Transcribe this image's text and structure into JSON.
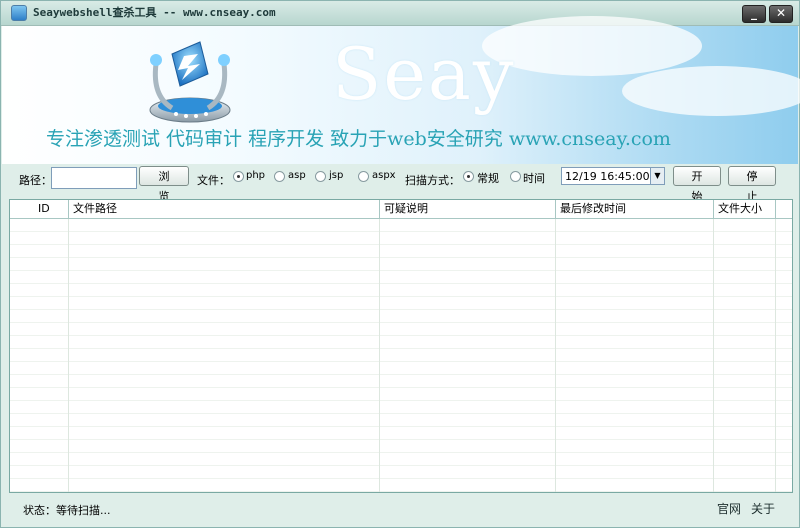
{
  "titlebar": {
    "title": "Seaywebshell查杀工具 -- www.cnseay.com",
    "minimize_glyph": "_",
    "close_glyph": "✕"
  },
  "banner": {
    "brand": "Seay",
    "slogan": "专注渗透测试 代码审计 程序开发 致力于web安全研究 www.cnseay.com"
  },
  "toolbar": {
    "path_label": "路径：",
    "path_value": "",
    "browse_label": "浏 览",
    "file_label": "文件：",
    "file_types": [
      {
        "label": "php",
        "checked": true
      },
      {
        "label": "asp",
        "checked": false
      },
      {
        "label": "jsp",
        "checked": false
      },
      {
        "label": "aspx",
        "checked": false
      }
    ],
    "scan_mode_label": "扫描方式：",
    "scan_modes": [
      {
        "label": "常规",
        "checked": true
      },
      {
        "label": "时间",
        "checked": false
      }
    ],
    "datetime_value": "12/19 16:45:00",
    "start_label": "开 始",
    "stop_label": "停 止"
  },
  "table": {
    "columns": [
      "ID",
      "文件路径",
      "可疑说明",
      "最后修改时间",
      "文件大小"
    ],
    "rows": []
  },
  "statusbar": {
    "status": "状态：等待扫描...",
    "official_site": "官网",
    "about": "关于"
  },
  "colors": {
    "window_bg": "#dfeee9",
    "slogan": "#29a3b5",
    "brand": "#ffffff"
  }
}
